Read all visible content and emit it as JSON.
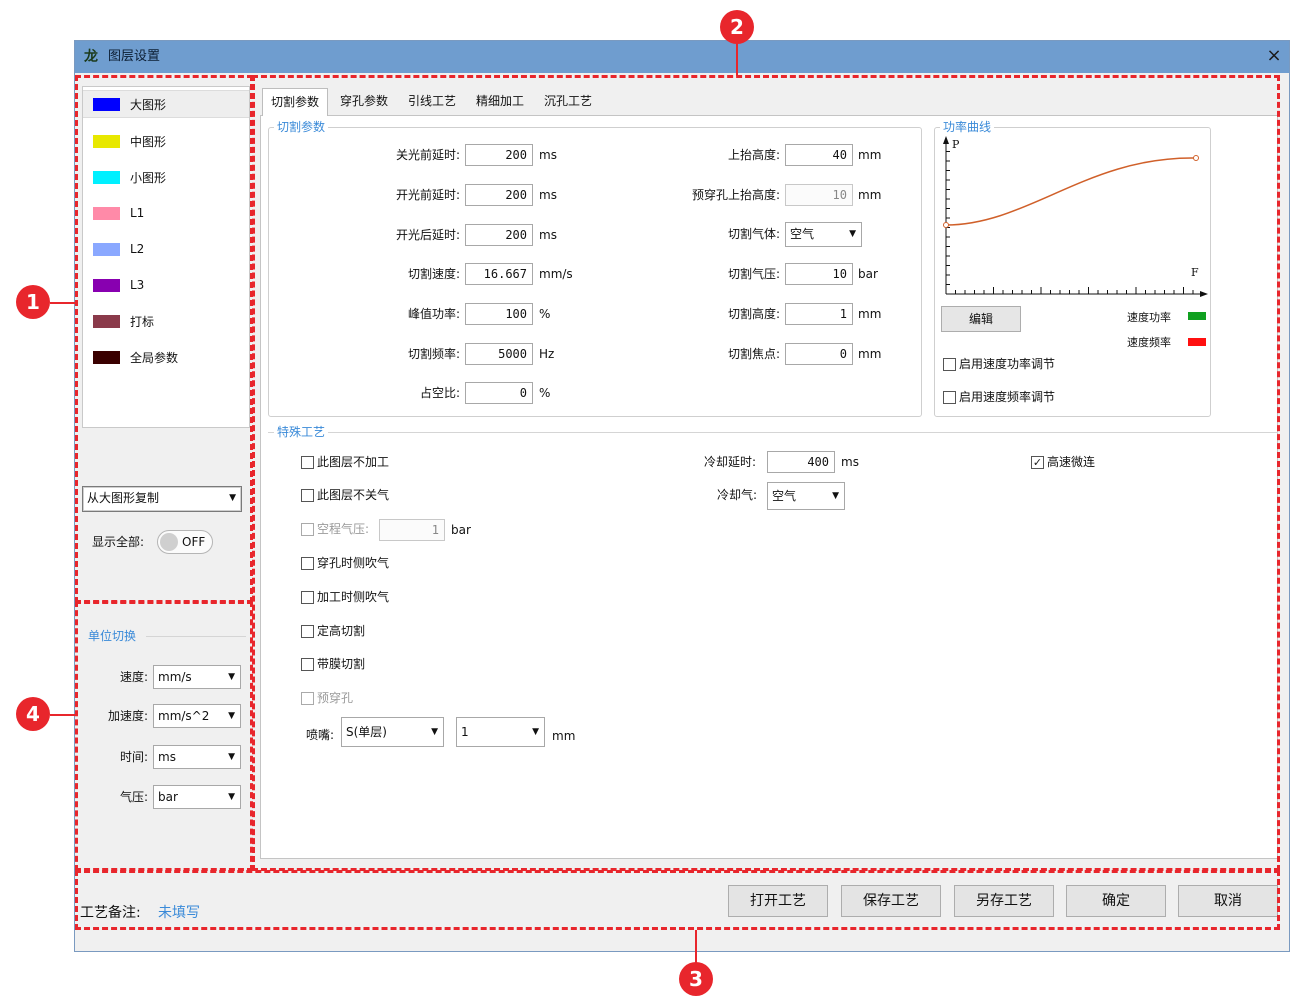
{
  "window": {
    "title": "图层设置",
    "close": "×"
  },
  "markers": [
    "1",
    "2",
    "3",
    "4"
  ],
  "layers": [
    {
      "name": "大图形",
      "color": "#0000ff"
    },
    {
      "name": "中图形",
      "color": "#e8e800"
    },
    {
      "name": "小图形",
      "color": "#00f0ff"
    },
    {
      "name": "L1",
      "color": "#ff8aa8"
    },
    {
      "name": "L2",
      "color": "#8aa8ff"
    },
    {
      "name": "L3",
      "color": "#8800b0"
    },
    {
      "name": "打标",
      "color": "#8a3a4a"
    },
    {
      "name": "全局参数",
      "color": "#3a0000"
    }
  ],
  "copy_select": "从大图形复制",
  "show_all": {
    "label": "显示全部:",
    "toggle": "OFF"
  },
  "units": {
    "title": "单位切换",
    "rows": [
      {
        "label": "速度:",
        "value": "mm/s"
      },
      {
        "label": "加速度:",
        "value": "mm/s^2"
      },
      {
        "label": "时间:",
        "value": "ms"
      },
      {
        "label": "气压:",
        "value": "bar"
      }
    ]
  },
  "tabs": [
    "切割参数",
    "穿孔参数",
    "引线工艺",
    "精细加工",
    "沉孔工艺"
  ],
  "cut": {
    "title": "切割参数",
    "left": [
      {
        "label": "关光前延时:",
        "value": "200",
        "unit": "ms"
      },
      {
        "label": "开光前延时:",
        "value": "200",
        "unit": "ms"
      },
      {
        "label": "开光后延时:",
        "value": "200",
        "unit": "ms"
      },
      {
        "label": "切割速度:",
        "value": "16.667",
        "unit": "mm/s"
      },
      {
        "label": "峰值功率:",
        "value": "100",
        "unit": "%"
      },
      {
        "label": "切割频率:",
        "value": "5000",
        "unit": "Hz"
      },
      {
        "label": "占空比:",
        "value": "0",
        "unit": "%"
      }
    ],
    "right": [
      {
        "label": "上抬高度:",
        "value": "40",
        "unit": "mm"
      },
      {
        "label": "预穿孔上抬高度:",
        "value": "10",
        "unit": "mm"
      },
      {
        "label": "切割气体:",
        "value": "空气",
        "unit": ""
      },
      {
        "label": "切割气压:",
        "value": "10",
        "unit": "bar"
      },
      {
        "label": "切割高度:",
        "value": "1",
        "unit": "mm"
      },
      {
        "label": "切割焦点:",
        "value": "0",
        "unit": "mm"
      }
    ]
  },
  "power": {
    "title": "功率曲线",
    "p_label": "P",
    "f_label": "F",
    "edit": "编辑",
    "legend": [
      {
        "label": "速度功率",
        "color": "#10a020"
      },
      {
        "label": "速度频率",
        "color": "#ff1010"
      }
    ],
    "checks": [
      "启用速度功率调节",
      "启用速度频率调节"
    ]
  },
  "special": {
    "title": "特殊工艺",
    "checks": [
      {
        "label": "此图层不加工",
        "checked": false,
        "disabled": false
      },
      {
        "label": "此图层不关气",
        "checked": false,
        "disabled": false
      },
      {
        "label": "空程气压:",
        "checked": false,
        "disabled": true
      },
      {
        "label": "穿孔时侧吹气",
        "checked": false,
        "disabled": false
      },
      {
        "label": "加工时侧吹气",
        "checked": false,
        "disabled": false
      },
      {
        "label": "定高切割",
        "checked": false,
        "disabled": false
      },
      {
        "label": "带膜切割",
        "checked": false,
        "disabled": false
      },
      {
        "label": "预穿孔",
        "checked": false,
        "disabled": true
      }
    ],
    "air_pressure": {
      "value": "1",
      "unit": "bar"
    },
    "nozzle": {
      "label": "喷嘴:",
      "type": "S(单层)",
      "size": "1",
      "unit": "mm"
    },
    "cool_delay": {
      "label": "冷却延时:",
      "value": "400",
      "unit": "ms"
    },
    "cool_gas": {
      "label": "冷却气:",
      "value": "空气"
    },
    "high_speed": {
      "label": "高速微连",
      "checked": true
    }
  },
  "bottom": {
    "note_label": "工艺备注:",
    "note_value": "未填写",
    "buttons": [
      "打开工艺",
      "保存工艺",
      "另存工艺",
      "确定",
      "取消"
    ]
  }
}
